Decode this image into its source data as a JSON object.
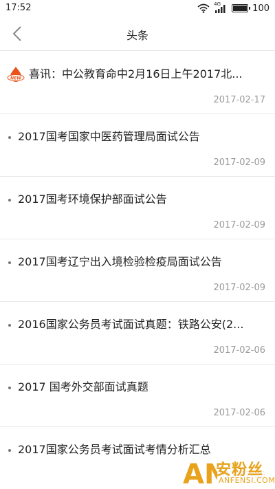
{
  "status_bar": {
    "time": "17:52",
    "network": "4G",
    "battery": "100",
    "battery_level": 1.0
  },
  "header": {
    "title": "头条",
    "back_icon": "chevron-left-icon"
  },
  "news_items": [
    {
      "title": "喜讯：中公教育命中2月16日上午2017北...",
      "date": "2017-02-17",
      "badge": "NEW"
    },
    {
      "title": "2017国考国家中医药管理局面试公告",
      "date": "2017-02-09"
    },
    {
      "title": "2017国考环境保护部面试公告",
      "date": "2017-02-09"
    },
    {
      "title": "2017国考辽宁出入境检验检疫局面试公告",
      "date": "2017-02-09"
    },
    {
      "title": "2016国家公务员考试面试真题：铁路公安(2...",
      "date": "2017-02-06"
    },
    {
      "title": "2017 国考外交部面试真题",
      "date": "2017-02-06"
    },
    {
      "title": "2017国家公务员考试面试考情分析汇总",
      "date": "2017-02-06"
    }
  ],
  "watermark": {
    "logo_text": "AN",
    "cn": "安粉丝",
    "en": "ANFENSI.COM"
  },
  "colors": {
    "accent": "#e8a21c",
    "badge": "#e8531c",
    "date": "#999999",
    "divider": "#e8e8e8"
  }
}
